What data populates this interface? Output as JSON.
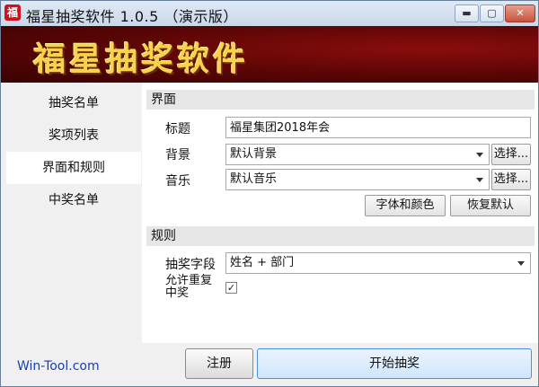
{
  "window": {
    "title": "福星抽奖软件 1.0.5 （演示版）",
    "app_icon_glyph": "福",
    "controls": {
      "minimize": "▬",
      "maximize": "▢",
      "close": "✕"
    }
  },
  "banner": {
    "title": "福星抽奖软件"
  },
  "nav": {
    "items": [
      {
        "label": "抽奖名单"
      },
      {
        "label": "奖项列表"
      },
      {
        "label": "界面和规则"
      },
      {
        "label": "中奖名单"
      }
    ],
    "selected": "界面和规则"
  },
  "interface_section": {
    "header": "界面",
    "title_label": "标题",
    "title_value": "福星集团2018年会",
    "background_label": "背景",
    "background_value": "默认背景",
    "background_button": "选择...",
    "music_label": "音乐",
    "music_value": "默认音乐",
    "music_button": "选择...",
    "font_color_button": "字体和颜色",
    "restore_default_button": "恢复默认"
  },
  "rules_section": {
    "header": "规则",
    "draw_field_label": "抽奖字段",
    "draw_field_value": "姓名 + 部门",
    "allow_repeat_label": "允许重复中奖",
    "allow_repeat_checked": true
  },
  "footer": {
    "link": "Win-Tool.com",
    "register_button": "注册",
    "start_button": "开始抽奖"
  },
  "colors": {
    "banner_bg": "#5a0505",
    "banner_text": "#f7d24a",
    "link": "#1a3fa8",
    "primary_button": "#cfe6fb"
  }
}
